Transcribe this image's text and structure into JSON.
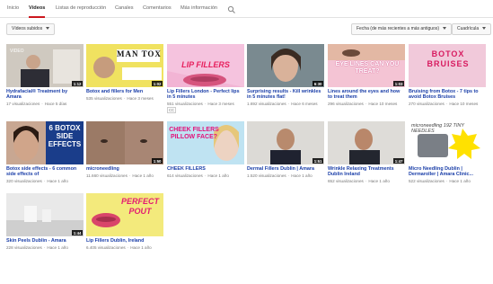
{
  "tabs": [
    "Inicio",
    "Vídeos",
    "Listas de reproducción",
    "Canales",
    "Comentarios",
    "Más información"
  ],
  "filters": {
    "uploaded": "Vídeos subidos",
    "sort": "Fecha (de más recientes a más antiguos)",
    "view": "Cuadrícula"
  },
  "videos": [
    {
      "title": "Hydrafacial® Treatment by Amara",
      "views": "17 visualizaciones",
      "age": "Hace 5 días",
      "duration": "1:12",
      "thumb_text": "",
      "thumb_logo": "VIDEO"
    },
    {
      "title": "Botox and fillers for Men",
      "views": "535 visualizaciones",
      "age": "Hace 3 meses",
      "duration": "1:02",
      "thumb_text": "MAN TOX"
    },
    {
      "title": "Lip Fillers London - Perfect lips in 5 minutes",
      "views": "551 visualizaciones",
      "age": "Hace 3 meses",
      "duration": "",
      "thumb_text": "LIP FILLERS",
      "cc": "CC"
    },
    {
      "title": "Surprising results - Kill wrinkles in 5 minutes flat!",
      "views": "1.692 visualizaciones",
      "age": "Hace 6 meses",
      "duration": "6:30",
      "thumb_text": ""
    },
    {
      "title": "Lines around the eyes and how to treat them",
      "views": "296 visualizaciones",
      "age": "Hace 10 meses",
      "duration": "1:03",
      "thumb_text": "EYE LINES CAN YOU TREAT?"
    },
    {
      "title": "Bruising from Botox - 7 tips to avoid Botox Bruises",
      "views": "270 visualizaciones",
      "age": "Hace 10 meses",
      "duration": "",
      "thumb_text": "BOTOX BRUISES"
    },
    {
      "title": "Botox side effects - 6 common side effects of",
      "views": "320 visualizaciones",
      "age": "Hace 1 año",
      "duration": "",
      "thumb_text": "6 BOTOX SIDE EFFECTS"
    },
    {
      "title": "microneedling",
      "views": "11.660 visualizaciones",
      "age": "Hace 1 año",
      "duration": "1:50",
      "thumb_text": ""
    },
    {
      "title": "CHEEK FILLERS",
      "views": "614 visualizaciones",
      "age": "Hace 1 año",
      "duration": "",
      "thumb_text": "CHEEK FILLERS PILLOW FACE?"
    },
    {
      "title": "Dermal Fillers Dublin | Amara",
      "views": "1.520 visualizaciones",
      "age": "Hace 1 año",
      "duration": "1:51",
      "thumb_text": ""
    },
    {
      "title": "Wrinkle Relaxing Treatments Dublin Ireland",
      "views": "652 visualizaciones",
      "age": "Hace 1 año",
      "duration": "1:47",
      "thumb_text": ""
    },
    {
      "title": "Micro Needling Dublin | Dermaroller | Amara Clinic...",
      "views": "522 visualizaciones",
      "age": "Hace 1 año",
      "duration": "",
      "thumb_text": "microneedling 192 TINY NEEDLES"
    },
    {
      "title": "Skin Peels Dublin - Amara",
      "views": "228 visualizaciones",
      "age": "Hace 1 año",
      "duration": "1:44",
      "thumb_text": ""
    },
    {
      "title": "Lip Fillers Dublin, Ireland",
      "views": "6.405 visualizaciones",
      "age": "Hace 1 año",
      "duration": "",
      "thumb_text": "PERFECT POUT"
    }
  ]
}
